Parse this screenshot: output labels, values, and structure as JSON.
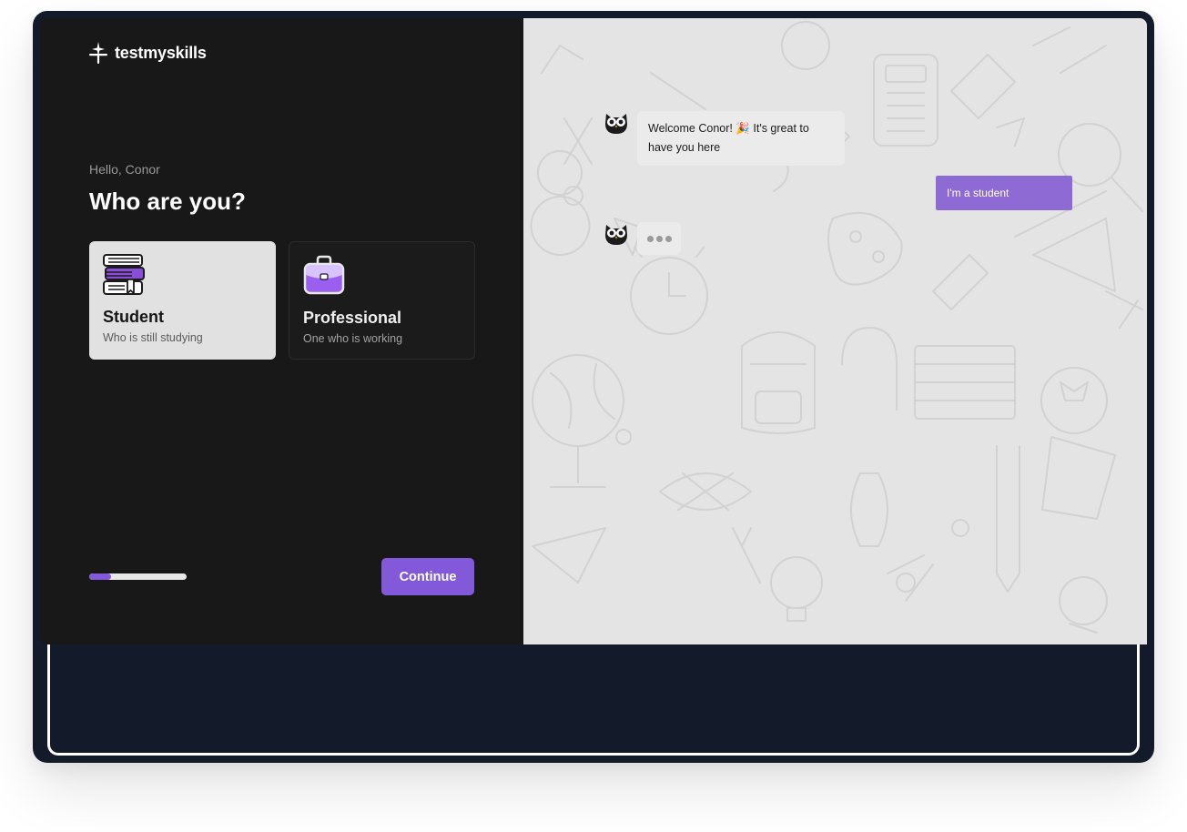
{
  "brand": {
    "name": "testmyskills"
  },
  "onboarding": {
    "greeting": "Hello, Conor",
    "title": "Who are you?",
    "options": [
      {
        "title": "Student",
        "subtitle": "Who is still studying",
        "icon": "stacked-books-icon",
        "selected": true
      },
      {
        "title": "Professional",
        "subtitle": "One who is working",
        "icon": "briefcase-icon",
        "selected": false
      }
    ],
    "progress": 0.22,
    "continue_label": "Continue"
  },
  "chat": {
    "messages": [
      {
        "from": "bot",
        "text": "Welcome Conor! 🎉 It's great to have you here"
      },
      {
        "from": "user",
        "text": "I'm a student"
      },
      {
        "from": "bot",
        "typing": true
      }
    ],
    "bot_avatar": "owl-icon"
  },
  "colors": {
    "accent": "#8259d9",
    "user_bubble": "#8e6bd4",
    "left_panel": "#181818",
    "right_panel": "#e4e4e4",
    "frame": "#131a2a"
  }
}
